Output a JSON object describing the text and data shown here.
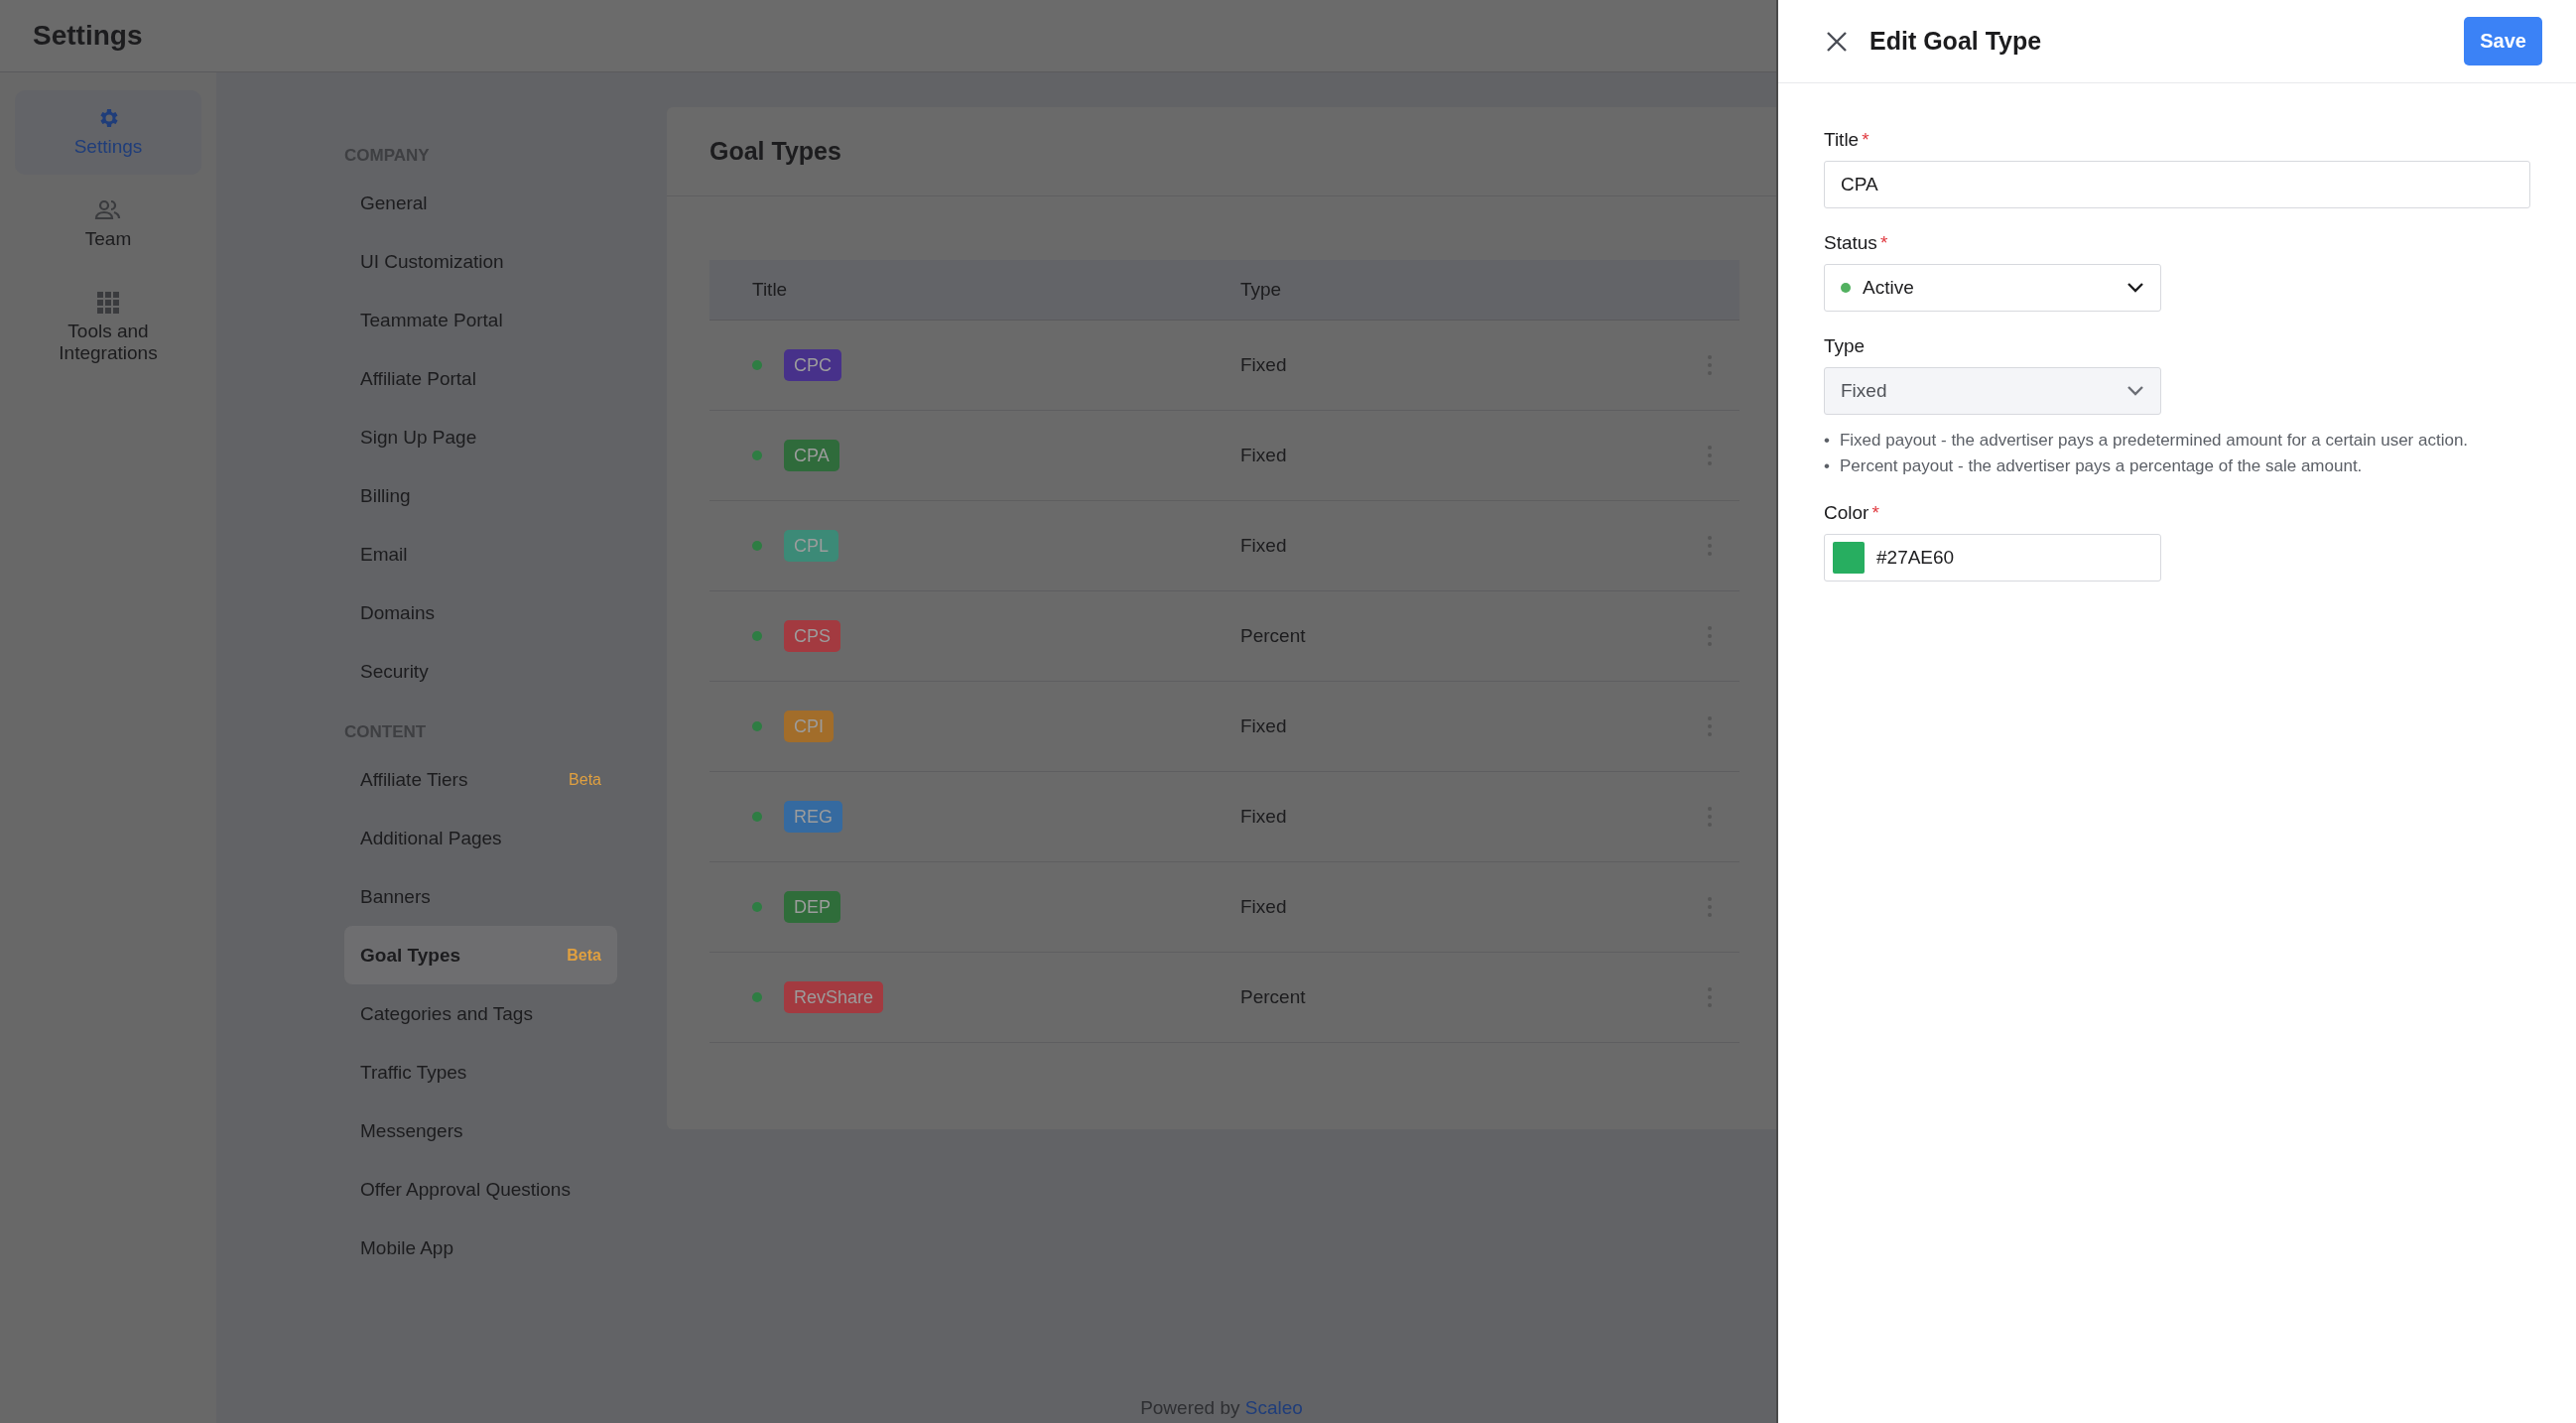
{
  "header": {
    "title": "Settings"
  },
  "nav": [
    {
      "label": "Settings",
      "selected": true
    },
    {
      "label": "Team",
      "selected": false
    },
    {
      "label": "Tools and Integrations",
      "selected": false
    }
  ],
  "menu": [
    {
      "heading": "COMPANY",
      "items": [
        {
          "label": "General",
          "selected": false
        },
        {
          "label": "UI Customization",
          "selected": false
        },
        {
          "label": "Teammate Portal",
          "selected": false
        },
        {
          "label": "Affiliate Portal",
          "selected": false
        },
        {
          "label": "Sign Up Page",
          "selected": false
        },
        {
          "label": "Billing",
          "selected": false
        },
        {
          "label": "Email",
          "selected": false
        },
        {
          "label": "Domains",
          "selected": false
        },
        {
          "label": "Security",
          "selected": false
        }
      ]
    },
    {
      "heading": "CONTENT",
      "items": [
        {
          "label": "Affiliate Tiers",
          "badge": "Beta",
          "selected": false
        },
        {
          "label": "Additional Pages",
          "selected": false
        },
        {
          "label": "Banners",
          "selected": false
        },
        {
          "label": "Goal Types",
          "badge": "Beta",
          "selected": true
        },
        {
          "label": "Categories and Tags",
          "selected": false
        },
        {
          "label": "Traffic Types",
          "selected": false
        },
        {
          "label": "Messengers",
          "selected": false
        },
        {
          "label": "Offer Approval Questions",
          "selected": false
        },
        {
          "label": "Mobile App",
          "selected": false
        }
      ]
    }
  ],
  "card": {
    "title": "Goal Types"
  },
  "table": {
    "columns": [
      "Title",
      "Type"
    ],
    "rows": [
      {
        "active": true,
        "title": "CPC",
        "color": "#47318a",
        "type": "Fixed"
      },
      {
        "active": true,
        "title": "CPA",
        "color": "#2f6b3b",
        "type": "Fixed"
      },
      {
        "active": true,
        "title": "CPL",
        "color": "#3c8a77",
        "type": "Fixed"
      },
      {
        "active": true,
        "title": "CPS",
        "color": "#a33a40",
        "type": "Percent"
      },
      {
        "active": true,
        "title": "CPI",
        "color": "#a26d2a",
        "type": "Fixed"
      },
      {
        "active": true,
        "title": "REG",
        "color": "#356aa0",
        "type": "Fixed"
      },
      {
        "active": true,
        "title": "DEP",
        "color": "#2f6d3a",
        "type": "Fixed"
      },
      {
        "active": true,
        "title": "RevShare",
        "color": "#a33a40",
        "type": "Percent"
      }
    ]
  },
  "footer": {
    "text": "Powered by",
    "link": "Scaleo"
  },
  "panel": {
    "title": "Edit Goal Type",
    "save": "Save",
    "fields": [
      {
        "kind": "text",
        "label": "Title",
        "required_mark": "*",
        "value": "CPA"
      },
      {
        "kind": "status",
        "label": "Status",
        "required_mark": "*",
        "value": "Active",
        "active": true
      },
      {
        "kind": "select",
        "label": "Type",
        "value": "Fixed",
        "disabled": true,
        "notes": [
          {
            "bullet": "•",
            "text": "Fixed payout - the advertiser pays a predetermined amount for a certain user action."
          },
          {
            "bullet": "•",
            "text": "Percent payout - the advertiser pays a percentage of the sale amount."
          }
        ]
      },
      {
        "kind": "color",
        "label": "Color",
        "required_mark": "*",
        "value": "#27AE60"
      }
    ]
  }
}
